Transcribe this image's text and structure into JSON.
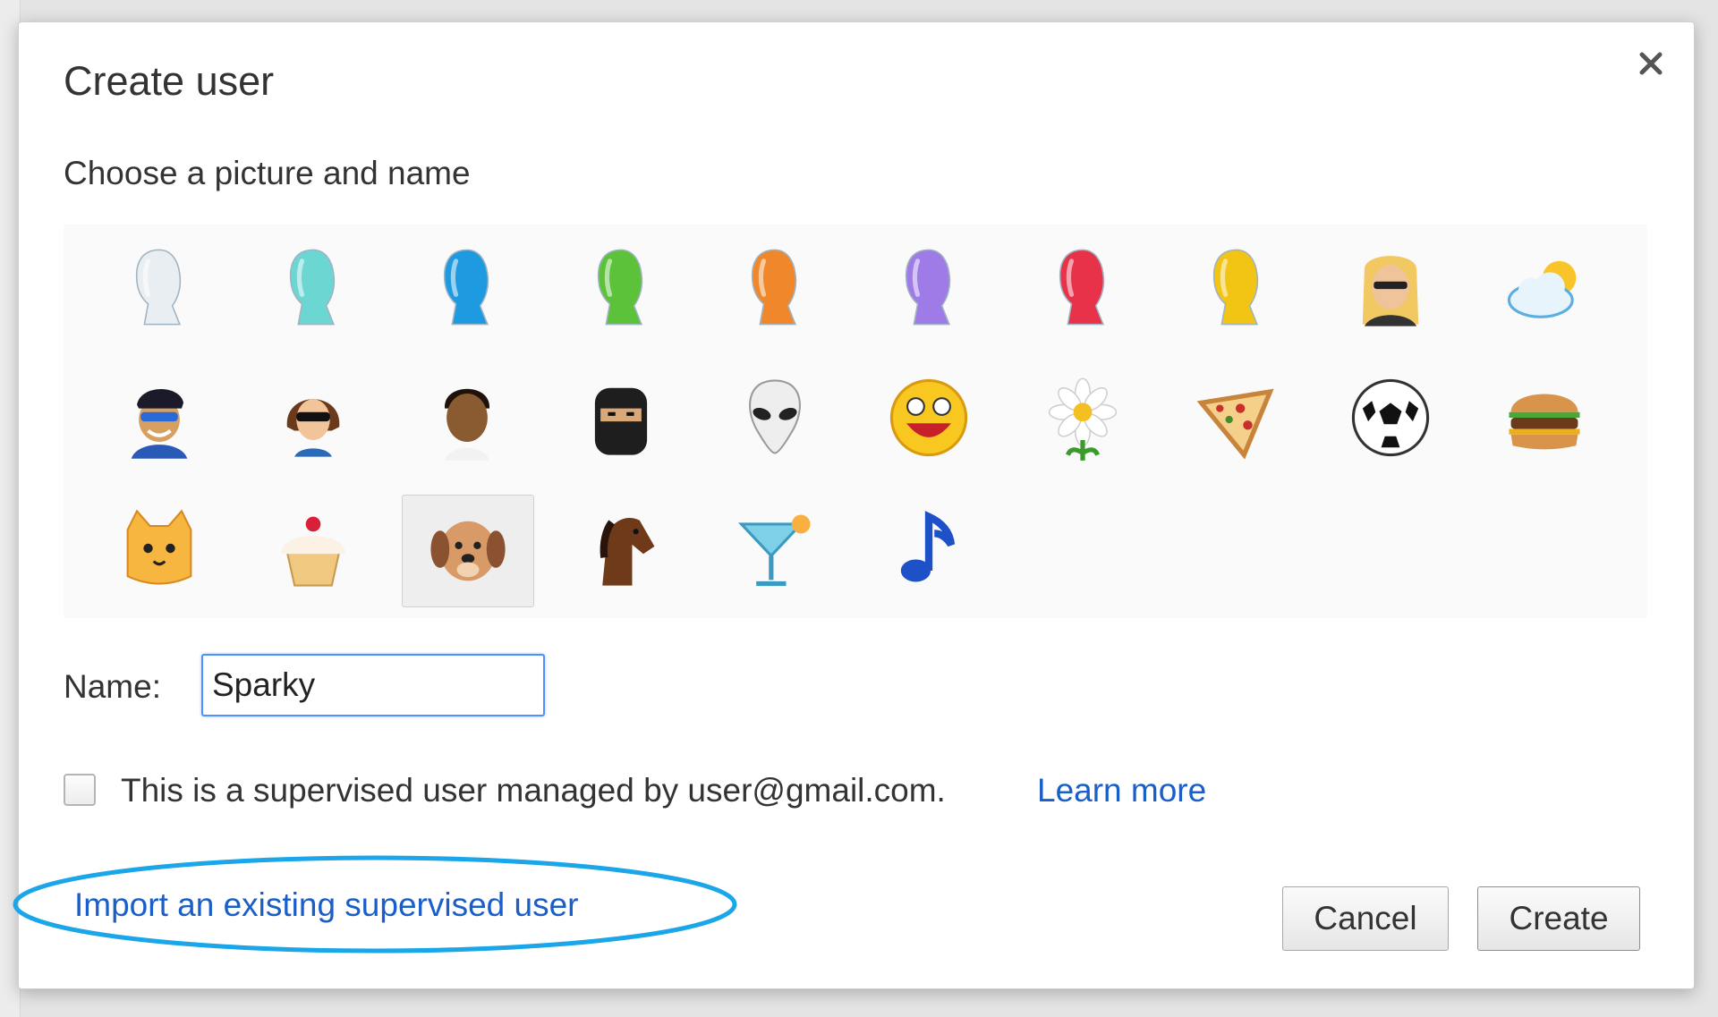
{
  "dialog": {
    "title": "Create user",
    "subtitle": "Choose a picture and name",
    "close_icon": "close-icon"
  },
  "avatars": [
    {
      "name": "white-silhouette",
      "icon": "white-head-icon",
      "color": "#e8eef2"
    },
    {
      "name": "teal-silhouette",
      "icon": "teal-head-icon",
      "color": "#6cd6d2"
    },
    {
      "name": "blue-silhouette",
      "icon": "blue-head-icon",
      "color": "#1e9be0"
    },
    {
      "name": "green-silhouette",
      "icon": "green-head-icon",
      "color": "#5cc23a"
    },
    {
      "name": "orange-silhouette",
      "icon": "orange-head-icon",
      "color": "#f0872a"
    },
    {
      "name": "purple-silhouette",
      "icon": "purple-head-icon",
      "color": "#9f7be8"
    },
    {
      "name": "red-silhouette",
      "icon": "red-head-icon",
      "color": "#e8324a"
    },
    {
      "name": "yellow-silhouette",
      "icon": "yellow-head-icon",
      "color": "#f2c414"
    },
    {
      "name": "businesswoman",
      "icon": "businesswoman-icon",
      "color": "#f0c060"
    },
    {
      "name": "cloud",
      "icon": "cloud-sun-icon",
      "color": "#7cc4ec"
    },
    {
      "name": "superhero",
      "icon": "superhero-icon",
      "color": "#2a5ab8"
    },
    {
      "name": "sunglasses-woman",
      "icon": "sunglasses-woman-icon",
      "color": "#8a5230"
    },
    {
      "name": "man",
      "icon": "man-icon",
      "color": "#6a4020"
    },
    {
      "name": "ninja",
      "icon": "ninja-icon",
      "color": "#1e1e1e"
    },
    {
      "name": "alien",
      "icon": "alien-icon",
      "color": "#e6e6e6"
    },
    {
      "name": "smiley",
      "icon": "smiley-icon",
      "color": "#f8c820"
    },
    {
      "name": "flower",
      "icon": "daisy-icon",
      "color": "#ffffff"
    },
    {
      "name": "pizza",
      "icon": "pizza-icon",
      "color": "#f4d08a"
    },
    {
      "name": "soccer-ball",
      "icon": "soccer-ball-icon",
      "color": "#ffffff"
    },
    {
      "name": "burger",
      "icon": "burger-icon",
      "color": "#c8843a"
    },
    {
      "name": "cat",
      "icon": "cat-icon",
      "color": "#f6b640"
    },
    {
      "name": "cupcake",
      "icon": "cupcake-icon",
      "color": "#f8e0b0"
    },
    {
      "name": "dog",
      "icon": "dog-icon",
      "color": "#c88a56",
      "selected": true
    },
    {
      "name": "horse",
      "icon": "horse-icon",
      "color": "#6e3a1a"
    },
    {
      "name": "cocktail",
      "icon": "cocktail-icon",
      "color": "#5ac0e0"
    },
    {
      "name": "music-note",
      "icon": "music-note-icon",
      "color": "#1e50c8"
    }
  ],
  "name_field": {
    "label": "Name:",
    "value": "Sparky"
  },
  "supervised": {
    "checked": false,
    "text": "This is a supervised user managed by user@gmail.com.",
    "learn_more": "Learn more"
  },
  "import_link": "Import an existing supervised user",
  "buttons": {
    "cancel": "Cancel",
    "create": "Create"
  },
  "colors": {
    "link": "#1a5ec9",
    "focus_border": "#4d90fe",
    "highlight_ellipse": "#1aa6e8"
  }
}
